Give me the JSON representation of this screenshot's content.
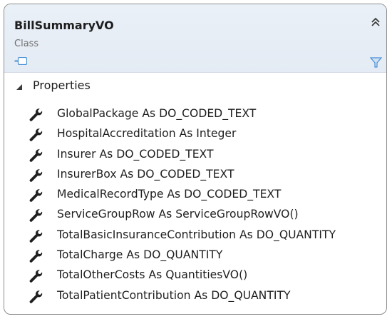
{
  "class": {
    "name": "BillSummaryVO",
    "kind": "Class",
    "glyph_icon": "class-shape-icon",
    "collapse_icon": "double-chevron-up-icon",
    "filter_icon": "filter-icon"
  },
  "section": {
    "arrow_icon": "expanded-triangle-icon",
    "title": "Properties"
  },
  "property_icon": "wrench-icon",
  "properties": [
    "GlobalPackage As DO_CODED_TEXT",
    "HospitalAccreditation As Integer",
    "Insurer As DO_CODED_TEXT",
    "InsurerBox As DO_CODED_TEXT",
    "MedicalRecordType As DO_CODED_TEXT",
    "ServiceGroupRow As ServiceGroupRowVO()",
    "TotalBasicInsuranceContribution As DO_QUANTITY",
    "TotalCharge As DO_QUANTITY",
    "TotalOtherCosts As QuantitiesVO()",
    "TotalPatientContribution As DO_QUANTITY"
  ],
  "colors": {
    "header_bg": "#e4ebf4",
    "border": "#8e8e8e",
    "icon_gray": "#1f1f1f",
    "glyph_blue": "#4a90d6"
  }
}
